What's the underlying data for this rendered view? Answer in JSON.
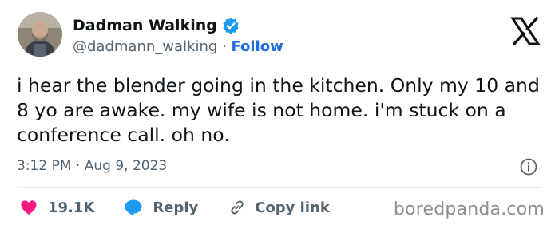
{
  "author": {
    "name": "Dadman Walking",
    "handle": "@dadmann_walking",
    "separator": " · ",
    "follow_label": "Follow"
  },
  "tweet": {
    "text": "i hear the blender going in the kitchen. Only my 10 and 8 yo are awake. my wife is not home. i'm stuck on a conference call. oh no.",
    "time": "3:12 PM",
    "separator": " · ",
    "date": "Aug 9, 2023"
  },
  "actions": {
    "like_count": "19.1K",
    "reply_label": "Reply",
    "copy_label": "Copy link"
  },
  "watermark": "boredpanda.com",
  "icons": {
    "verified": "verified-badge-icon",
    "x_logo": "x-logo-icon",
    "info": "info-icon",
    "heart": "heart-icon",
    "reply": "reply-bubble-icon",
    "link": "link-icon"
  },
  "colors": {
    "text": "#0f1419",
    "secondary": "#536471",
    "follow": "#1d6fe0",
    "verified": "#1d9bf0",
    "heart": "#f91880",
    "reply": "#1d9bf0"
  }
}
